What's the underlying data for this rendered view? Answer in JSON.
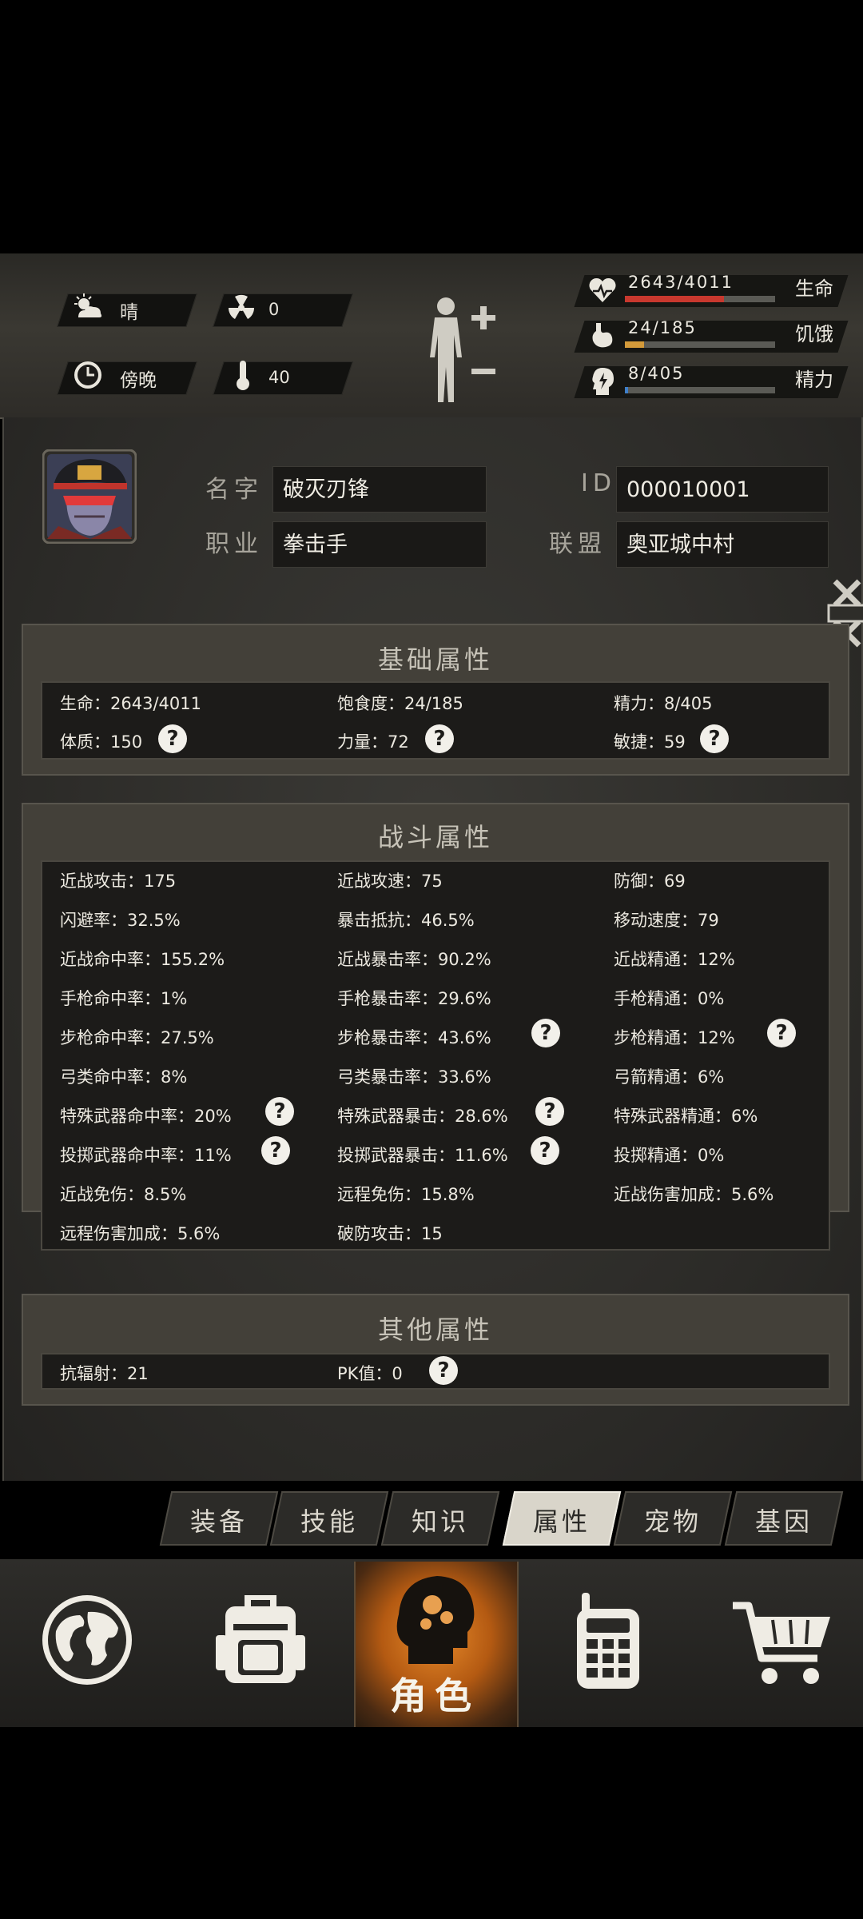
{
  "environment": {
    "weather": "晴",
    "radiation": "0",
    "time_of_day": "傍晚",
    "temperature": "40"
  },
  "vitals": {
    "health": {
      "text": "2643/4011",
      "label": "生命",
      "value": 2643,
      "max": 4011,
      "color": "#c8382e"
    },
    "hunger": {
      "text": "24/185",
      "label": "饥饿",
      "value": 24,
      "max": 185,
      "color": "#d39a3a"
    },
    "energy": {
      "text": "8/405",
      "label": "精力",
      "value": 8,
      "max": 405,
      "color": "#3f7fc9"
    }
  },
  "profile": {
    "name_label": "名字",
    "name": "破灭刃锋",
    "id_label": "ID",
    "id": "000010001",
    "class_label": "职业",
    "class": "拳击手",
    "alliance_label": "联盟",
    "alliance": "奥亚城中村"
  },
  "basic": {
    "title": "基础属性",
    "stats": [
      "生命：2643/4011",
      "饱食度：24/185",
      "精力：8/405",
      "体质：150",
      "力量：72",
      "敏捷：59"
    ]
  },
  "combat": {
    "title": "战斗属性",
    "stats": [
      "近战攻击：175",
      "近战攻速：75",
      "防御：69",
      "闪避率：32.5%",
      "暴击抵抗：46.5%",
      "移动速度：79",
      "近战命中率：155.2%",
      "近战暴击率：90.2%",
      "近战精通：12%",
      "手枪命中率：1%",
      "手枪暴击率：29.6%",
      "手枪精通：0%",
      "步枪命中率：27.5%",
      "步枪暴击率：43.6%",
      "步枪精通：12%",
      "弓类命中率：8%",
      "弓类暴击率：33.6%",
      "弓箭精通：6%",
      "特殊武器命中率：20%",
      "特殊武器暴击：28.6%",
      "特殊武器精通：6%",
      "投掷武器命中率：11%",
      "投掷武器暴击：11.6%",
      "投掷精通：0%",
      "近战免伤：8.5%",
      "远程免伤：15.8%",
      "近战伤害加成：5.6%",
      "远程伤害加成：5.6%",
      "破防攻击：15"
    ]
  },
  "other": {
    "title": "其他属性",
    "stats": [
      "抗辐射：21",
      "PK值：0"
    ]
  },
  "help_glyph": "?",
  "tabs": [
    "装备",
    "技能",
    "知识",
    "属性",
    "宠物",
    "基因"
  ],
  "active_tab": "属性",
  "nav": {
    "character_label": "角色",
    "items": [
      "world-map",
      "backpack",
      "character",
      "radio-phone",
      "shop-cart"
    ]
  }
}
